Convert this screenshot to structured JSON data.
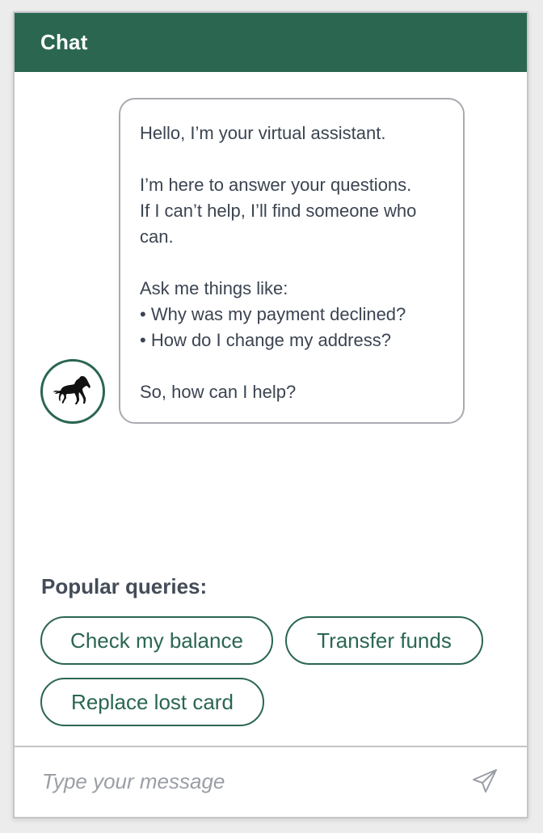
{
  "header": {
    "title": "Chat"
  },
  "avatar": {
    "icon": "black-horse-logo-icon",
    "color": "#2a6650"
  },
  "message": {
    "lines": [
      "Hello, I’m your virtual assistant.",
      "I’m here to answer your questions.",
      "If I can’t help, I’ll find someone who",
      "can.",
      "Ask me things like:",
      "• Why was my payment declined?",
      "• How do I change my address?",
      "So, how can I help?"
    ]
  },
  "queries": {
    "title": "Popular queries:",
    "items": [
      "Check my balance",
      "Transfer funds",
      "Replace lost card"
    ]
  },
  "composer": {
    "placeholder": "Type your message",
    "send_icon": "send-paper-plane-icon"
  },
  "colors": {
    "brand": "#2a6650",
    "text": "#3b4451",
    "border": "#c3c5c9"
  }
}
